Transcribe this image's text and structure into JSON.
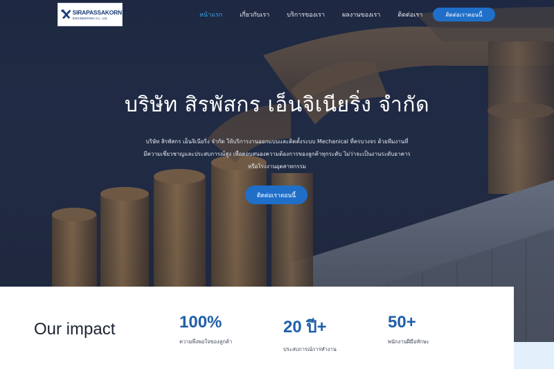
{
  "brand": {
    "logo_name": "SIRAPASSAKORN",
    "logo_sub": "ENGINEERING Co., Ltd."
  },
  "nav": {
    "items": [
      {
        "label": "หน้าแรก",
        "active": true
      },
      {
        "label": "เกี่ยวกับเรา",
        "active": false
      },
      {
        "label": "บริการของเรา",
        "active": false
      },
      {
        "label": "ผลงานของเรา",
        "active": false
      },
      {
        "label": "ติดต่อเรา",
        "active": false
      }
    ],
    "language": "TH",
    "cta_label": "ติดต่อเราตอนนี้"
  },
  "hero": {
    "title": "บริษัท สิรพัสกร เอ็นจิเนียริ่ง จำกัด",
    "desc_line1": "บริษัท สิรพัสกร เอ็นจิเนียริ่ง จำกัด ให้บริการงานออกแบบและติดตั้งระบบ Mechanical ที่ครบวงจร ด้วยทีมงานที่",
    "desc_line2": "มีความเชี่ยวชาญและประสบการณ์สูง เพื่อตอบสนองความต้องการของลูกค้าทุกระดับ ไม่ว่าจะเป็นงานระดับอาคาร",
    "desc_line3": "หรือโรงงานอุตสาหกรรม",
    "cta_label": "ติดต่อเราตอนนี้"
  },
  "impact": {
    "title": "Our impact",
    "stats": [
      {
        "value": "100%",
        "label": "ความพึงพอใจของลูกค้า"
      },
      {
        "value": "20 ปี+",
        "label": "ประสบการณ์การทำงาน"
      },
      {
        "value": "50+",
        "label": "พนักงานฝีมือทักษะ"
      }
    ]
  },
  "colors": {
    "accent": "#1f6fc9",
    "nav_active": "#3aa0e6",
    "stat_value": "#1f5fa8"
  }
}
